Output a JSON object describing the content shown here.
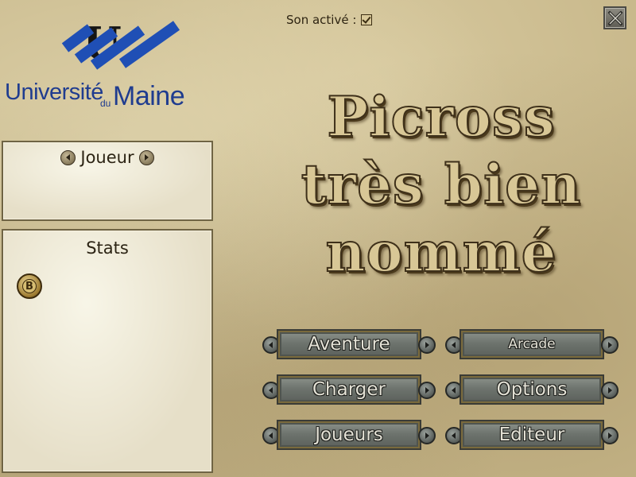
{
  "sound": {
    "label": "Son activé :",
    "checked": true
  },
  "close": {
    "icon": "close-icon"
  },
  "logo": {
    "line1": "Université",
    "small": "du",
    "line2": "Maine",
    "colors": {
      "primary": "#1f3c8f",
      "stripes": "#1f4fb5"
    }
  },
  "player_panel": {
    "title": "Joueur",
    "prev_icon": "arrow-left-icon",
    "next_icon": "arrow-right-icon"
  },
  "stats_panel": {
    "title": "Stats",
    "coin_letter": "B"
  },
  "game_title": {
    "lines": [
      "Picross",
      "très bien",
      "nommé"
    ]
  },
  "menu": {
    "aventure": "Aventure",
    "arcade": "Arcade",
    "charger": "Charger",
    "options": "Options",
    "joueurs": "Joueurs",
    "editeur": "Editeur"
  }
}
